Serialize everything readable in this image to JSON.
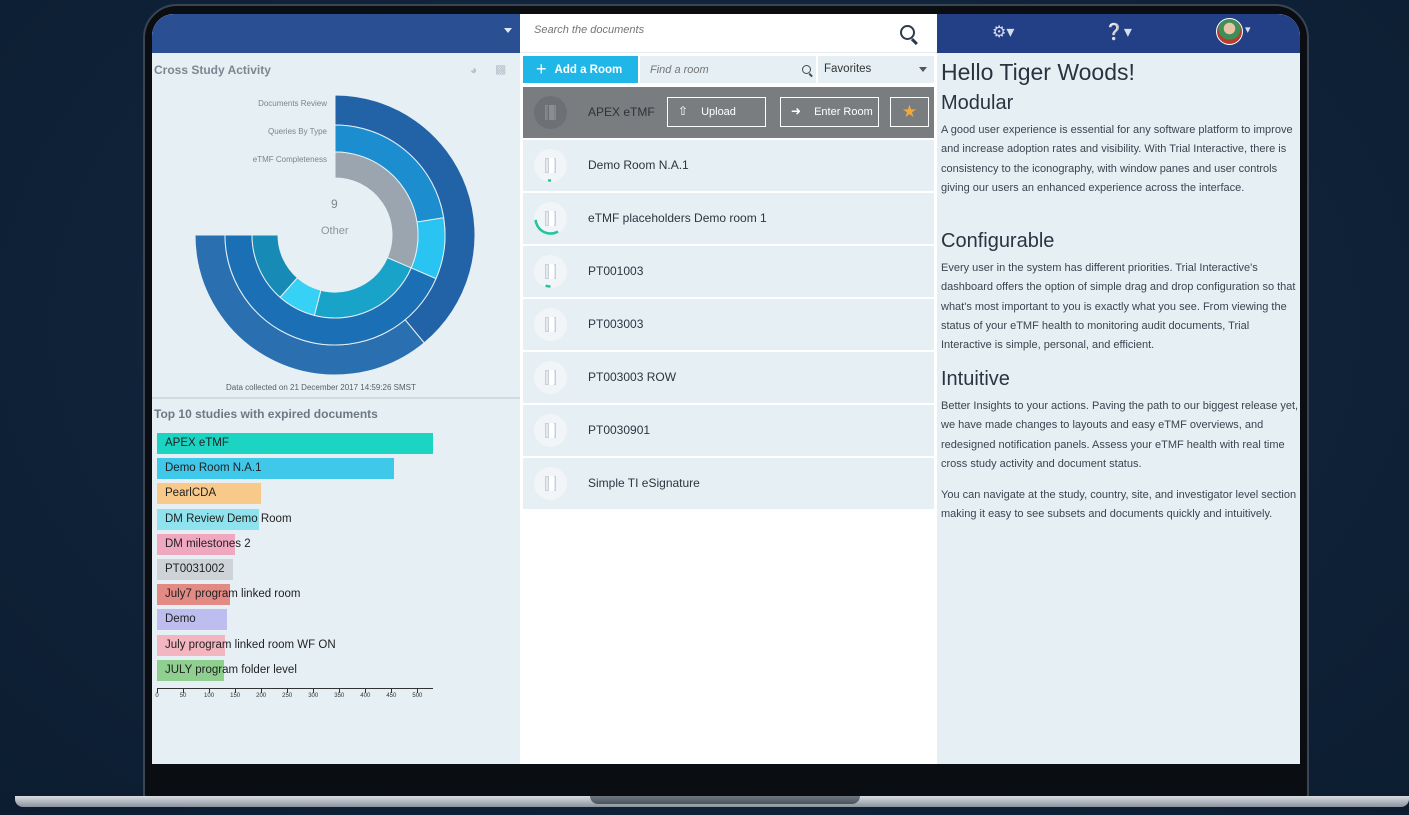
{
  "left_panel": {
    "title": "Cross Study Activity",
    "ring_labels": [
      "Documents Review",
      "Queries By Type",
      "eTMF Completeness"
    ],
    "center_value": "9",
    "center_label": "Other",
    "collected_text": "Data collected on 21 December 2017 14:59:26 SMST",
    "bars_title": "Top 10 studies with expired documents"
  },
  "chart_data": [
    {
      "type": "pie",
      "title": "",
      "series": [
        {
          "name": "Documents Review",
          "values": [
            52,
            48
          ],
          "colors": [
            "#2263a7",
            "#2a6fb0"
          ]
        },
        {
          "name": "Queries By Type",
          "values": [
            30,
            12,
            58
          ],
          "colors": [
            "#1c8ed0",
            "#29c4f2",
            "#1b6fb5"
          ]
        },
        {
          "name": "eTMF Completeness",
          "values": [
            42,
            30,
            10,
            18
          ],
          "colors": [
            "#9aa5af",
            "#1aa3c8",
            "#36d1f5",
            "#178bb6"
          ]
        }
      ],
      "center_value": 9,
      "center_label": "Other"
    },
    {
      "type": "bar",
      "title": "Top 10 studies with expired documents",
      "categories": [
        "APEX eTMF",
        "Demo Room N.A.1",
        "PearlCDA",
        "DM Review Demo Room",
        "DM milestones 2",
        "PT0031002",
        "July7 program linked room",
        "Demo",
        "July program linked room WF ON",
        "JULY program folder level"
      ],
      "values": [
        530,
        455,
        200,
        195,
        150,
        145,
        140,
        135,
        130,
        128
      ],
      "colors": [
        "#1cd4c2",
        "#3fc8ea",
        "#f9c98a",
        "#8ee3ee",
        "#f0a8c0",
        "#cdd3d6",
        "#e48a84",
        "#bdbdef",
        "#f3b6c1",
        "#8fcf90"
      ],
      "xlim": [
        0,
        530
      ],
      "xticks": [
        0,
        50,
        100,
        150,
        200,
        250,
        300,
        350,
        400,
        450,
        500
      ]
    }
  ],
  "middle_panel": {
    "search_placeholder": "Search the documents",
    "add_room_label": "Add a Room",
    "find_room_placeholder": "Find a room",
    "favorites_label": "Favorites",
    "upload_label": "Upload",
    "enter_room_label": "Enter Room",
    "rooms": [
      {
        "name": "APEX eTMF"
      },
      {
        "name": "Demo Room N.A.1"
      },
      {
        "name": "eTMF placeholders Demo room 1"
      },
      {
        "name": "PT001003"
      },
      {
        "name": "PT003003"
      },
      {
        "name": "PT003003 ROW"
      },
      {
        "name": "PT0030901"
      },
      {
        "name": "Simple TI eSignature"
      }
    ]
  },
  "right_panel": {
    "greeting": "Hello Tiger Woods!",
    "sections": [
      {
        "heading": "Modular",
        "body": "A good user experience is essential for any software platform to improve and increase adoption rates and visibility. With Trial Interactive, there is consistency to the iconography, with window panes and user controls giving our users an enhanced experience across the interface."
      },
      {
        "heading": "Configurable",
        "body": "Every user in the system has different priorities. Trial Interactive's dashboard offers the option of simple drag and drop configuration so that what's most important to you is exactly what you see. From viewing the status of your eTMF health to monitoring audit documents, Trial Interactive is simple, personal, and efficient."
      },
      {
        "heading": "Intuitive",
        "body": "Better Insights to your actions. Paving the path to our biggest release yet, we have made changes to layouts and easy eTMF overviews, and redesigned notification panels. Assess your eTMF health with real time cross study activity and document status."
      }
    ],
    "closing": "You can navigate at the study, country, site, and investigator level section making it easy to see subsets and documents quickly and intuitively."
  }
}
